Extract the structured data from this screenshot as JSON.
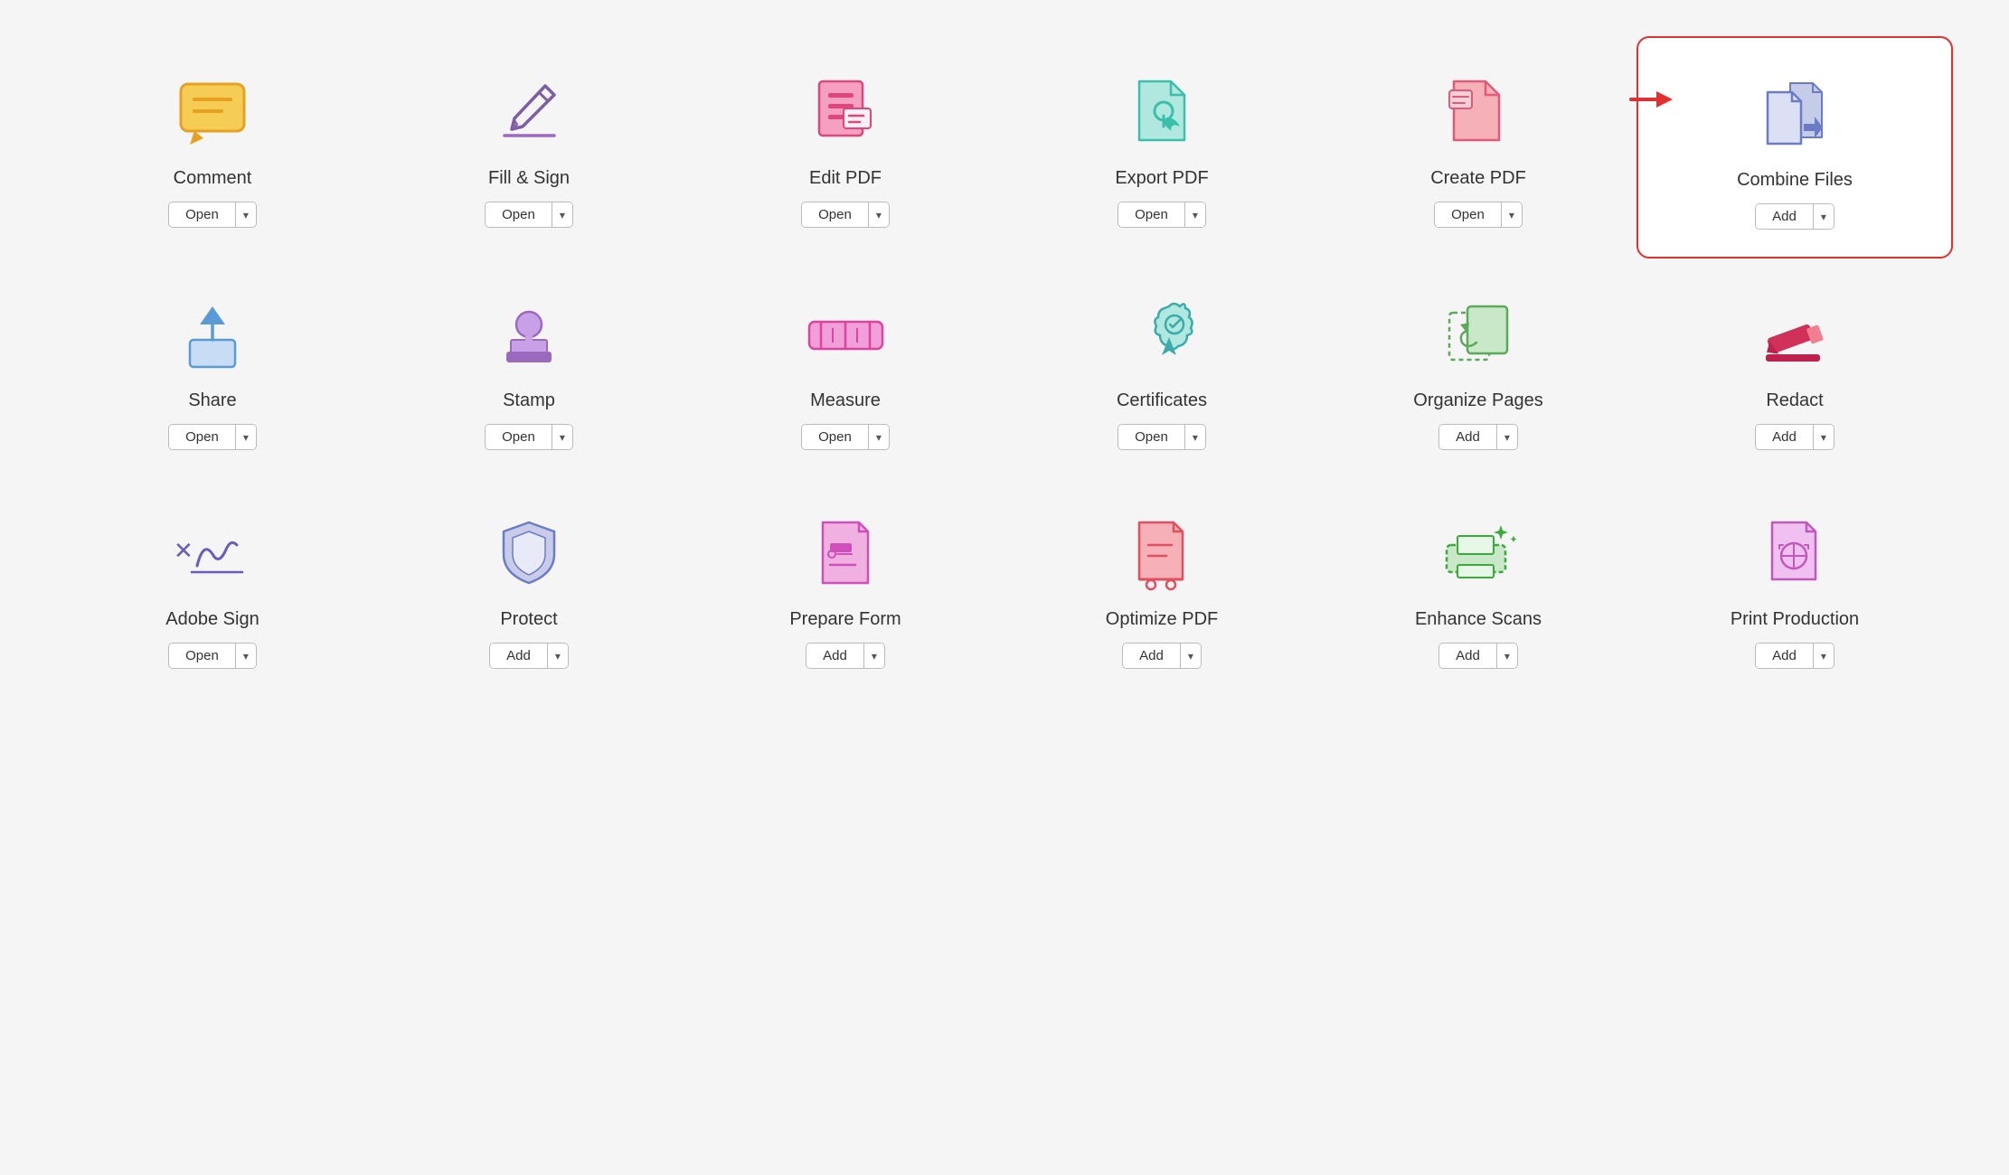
{
  "tools": [
    {
      "id": "comment",
      "label": "Comment",
      "button": "Open",
      "highlighted": false,
      "hasArrow": false,
      "iconColor": "#e8a020",
      "iconType": "comment"
    },
    {
      "id": "fill-sign",
      "label": "Fill & Sign",
      "button": "Open",
      "highlighted": false,
      "hasArrow": false,
      "iconColor": "#7b5ea7",
      "iconType": "fill-sign"
    },
    {
      "id": "edit-pdf",
      "label": "Edit PDF",
      "button": "Open",
      "highlighted": false,
      "hasArrow": false,
      "iconColor": "#e0457b",
      "iconType": "edit-pdf"
    },
    {
      "id": "export-pdf",
      "label": "Export PDF",
      "button": "Open",
      "highlighted": false,
      "hasArrow": false,
      "iconColor": "#3abfaa",
      "iconType": "export-pdf"
    },
    {
      "id": "create-pdf",
      "label": "Create PDF",
      "button": "Open",
      "highlighted": false,
      "hasArrow": true,
      "iconColor": "#e05a7a",
      "iconType": "create-pdf"
    },
    {
      "id": "combine-files",
      "label": "Combine Files",
      "button": "Add",
      "highlighted": true,
      "hasArrow": false,
      "iconColor": "#6b7cc7",
      "iconType": "combine-files"
    },
    {
      "id": "share",
      "label": "Share",
      "button": "Open",
      "highlighted": false,
      "hasArrow": false,
      "iconColor": "#5b9bd5",
      "iconType": "share"
    },
    {
      "id": "stamp",
      "label": "Stamp",
      "button": "Open",
      "highlighted": false,
      "hasArrow": false,
      "iconColor": "#9b6abf",
      "iconType": "stamp"
    },
    {
      "id": "measure",
      "label": "Measure",
      "button": "Open",
      "highlighted": false,
      "hasArrow": false,
      "iconColor": "#e040a0",
      "iconType": "measure"
    },
    {
      "id": "certificates",
      "label": "Certificates",
      "button": "Open",
      "highlighted": false,
      "hasArrow": false,
      "iconColor": "#3aabaa",
      "iconType": "certificates"
    },
    {
      "id": "organize-pages",
      "label": "Organize Pages",
      "button": "Add",
      "highlighted": false,
      "hasArrow": false,
      "iconColor": "#5aaa5a",
      "iconType": "organize-pages"
    },
    {
      "id": "redact",
      "label": "Redact",
      "button": "Add",
      "highlighted": false,
      "hasArrow": false,
      "iconColor": "#e0457b",
      "iconType": "redact"
    },
    {
      "id": "adobe-sign",
      "label": "Adobe Sign",
      "button": "Open",
      "highlighted": false,
      "hasArrow": false,
      "iconColor": "#6b5abf",
      "iconType": "adobe-sign"
    },
    {
      "id": "protect",
      "label": "Protect",
      "button": "Add",
      "highlighted": false,
      "hasArrow": false,
      "iconColor": "#6b7cc7",
      "iconType": "protect"
    },
    {
      "id": "prepare-form",
      "label": "Prepare Form",
      "button": "Add",
      "highlighted": false,
      "hasArrow": false,
      "iconColor": "#d04fba",
      "iconType": "prepare-form"
    },
    {
      "id": "optimize-pdf",
      "label": "Optimize PDF",
      "button": "Add",
      "highlighted": false,
      "hasArrow": false,
      "iconColor": "#e05060",
      "iconType": "optimize-pdf"
    },
    {
      "id": "enhance-scans",
      "label": "Enhance Scans",
      "button": "Add",
      "highlighted": false,
      "hasArrow": false,
      "iconColor": "#3aaa3a",
      "iconType": "enhance-scans"
    },
    {
      "id": "print-production",
      "label": "Print Production",
      "button": "Add",
      "highlighted": false,
      "hasArrow": false,
      "iconColor": "#c05aba",
      "iconType": "print-production"
    }
  ]
}
